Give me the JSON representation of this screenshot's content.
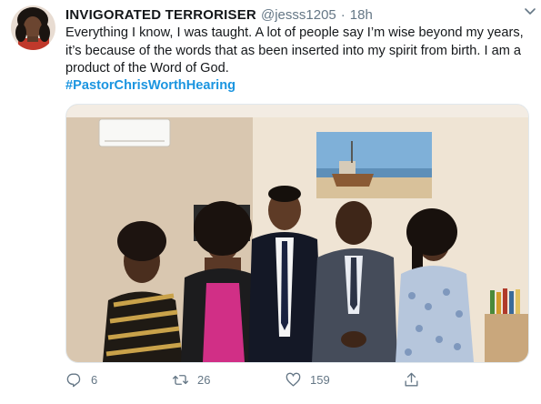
{
  "tweet": {
    "display_name": "INVIGORATED TERRORISER",
    "handle": "@jesss1205",
    "separator": "·",
    "time": "18h",
    "text": "Everything I know, I was taught. A lot of people say I’m wise beyond my years, it’s because of the words that as been inserted into my spirit from birth. I am a product of the Word of God.",
    "hashtag": "#PastorChrisWorthHearing",
    "actions": {
      "replies": "6",
      "retweets": "26",
      "likes": "159"
    }
  },
  "icons": {
    "reply": "reply-icon",
    "retweet": "retweet-icon",
    "like": "heart-icon",
    "share": "share-icon",
    "menu": "chevron-down-icon"
  },
  "colors": {
    "hashtag": "#1b95e0",
    "muted": "#657786",
    "text": "#14171a"
  }
}
